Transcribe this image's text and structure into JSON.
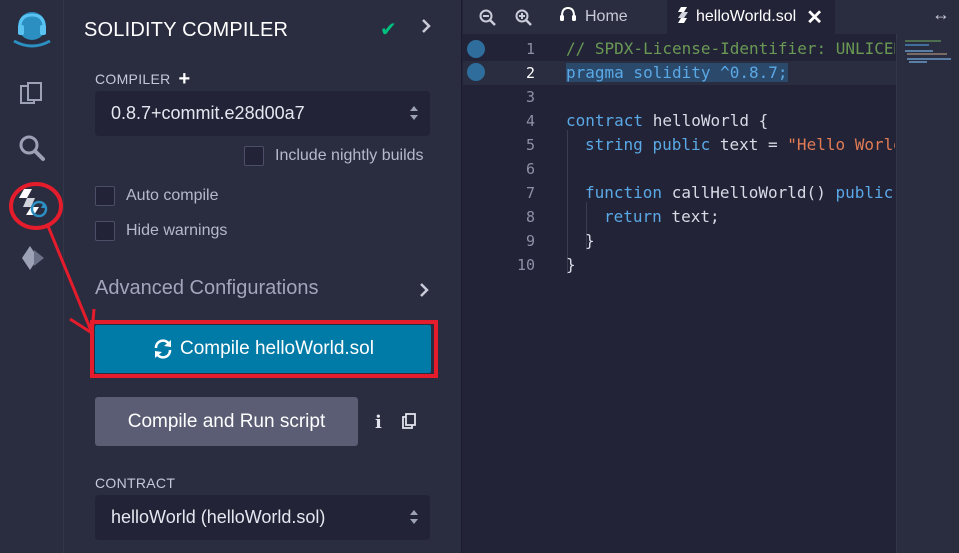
{
  "panel": {
    "title": "SOLIDITY COMPILER",
    "compiler_label": "COMPILER",
    "compiler_version": "0.8.7+commit.e28d00a7",
    "include_nightly_label": "Include nightly builds",
    "auto_compile_label": "Auto compile",
    "hide_warnings_label": "Hide warnings",
    "advanced_label": "Advanced Configurations",
    "compile_button_label": "Compile helloWorld.sol",
    "run_script_label": "Compile and Run script",
    "contract_label": "CONTRACT",
    "contract_value": "helloWorld (helloWorld.sol)"
  },
  "rail": {
    "icons": [
      "remix-logo-icon",
      "file-explorer-icon",
      "search-icon",
      "solidity-compiler-icon",
      "deploy-run-icon"
    ]
  },
  "editor": {
    "tabs": [
      {
        "label": "Home",
        "icon": "home-headset-icon"
      },
      {
        "label": "helloWorld.sol",
        "icon": "solidity-file-icon",
        "active": true
      }
    ],
    "line_numbers": [
      "1",
      "2",
      "3",
      "4",
      "5",
      "6",
      "7",
      "8",
      "9",
      "10"
    ],
    "code": {
      "l1": "// SPDX-License-Identifier: UNLICENSED",
      "l2_kw": "pragma solidity ^0.8.7;",
      "l4_kw": "contract",
      "l4_rest": " helloWorld {",
      "l5_kw1": "string",
      "l5_kw2": "public",
      "l5_mid": " text = ",
      "l5_str": "\"Hello World\";",
      "l7_kw": "function",
      "l7_mid": " callHelloWorld() ",
      "l7_kw2": "public view returns (string memory) {",
      "l8_kw": "return",
      "l8_rest": " text;",
      "l9": "}",
      "l10": "}"
    }
  },
  "colors": {
    "accent": "#007aa6",
    "highlight_red": "#e41c2b",
    "success": "#00c07f",
    "background": "#222336",
    "panel": "#2a2c3f"
  }
}
